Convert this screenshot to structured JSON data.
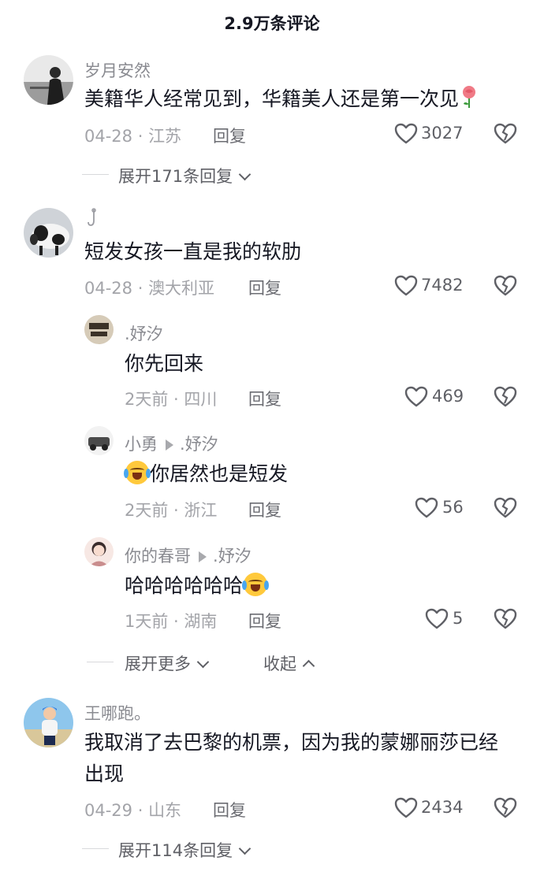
{
  "header": {
    "title": "2.9万条评论"
  },
  "comments": [
    {
      "username": "岁月安然",
      "text": "美籍华人经常见到，华籍美人还是第一次见",
      "emoji": "rose-emoji",
      "date": "04-28",
      "location": "江苏",
      "reply": "回复",
      "likes": "3027",
      "expand": "展开171条回复"
    },
    {
      "username": "",
      "username_icon": "hook-icon",
      "text": "短发女孩一直是我的软肋",
      "date": "04-28",
      "location": "澳大利亚",
      "reply": "回复",
      "likes": "7482",
      "replies": [
        {
          "username": ".妤汐",
          "text": "你先回来",
          "date": "2天前",
          "location": "四川",
          "reply": "回复",
          "likes": "469"
        },
        {
          "username": "小勇",
          "reply_to": ".妤汐",
          "text": "你居然也是短发",
          "emoji": "laughing-crying-emoji",
          "date": "2天前",
          "location": "浙江",
          "reply": "回复",
          "likes": "56"
        },
        {
          "username": "你的春哥",
          "reply_to": ".妤汐",
          "text": "哈哈哈哈哈哈",
          "emoji": "laughing-crying-emoji",
          "date": "1天前",
          "location": "湖南",
          "reply": "回复",
          "likes": "5"
        }
      ],
      "expand_more": "展开更多",
      "collapse": "收起"
    },
    {
      "username": "王哪跑。",
      "text_line1": "我取消了去巴黎的机票，因为我的蒙娜丽莎已经",
      "text_line2": "出现",
      "date": "04-29",
      "location": "山东",
      "reply": "回复",
      "likes": "2434",
      "expand": "展开114条回复"
    }
  ],
  "separator": " · ",
  "colors": {
    "text": "#161823",
    "secondary": "#8a8b91",
    "meta": "#a3a4a9"
  }
}
